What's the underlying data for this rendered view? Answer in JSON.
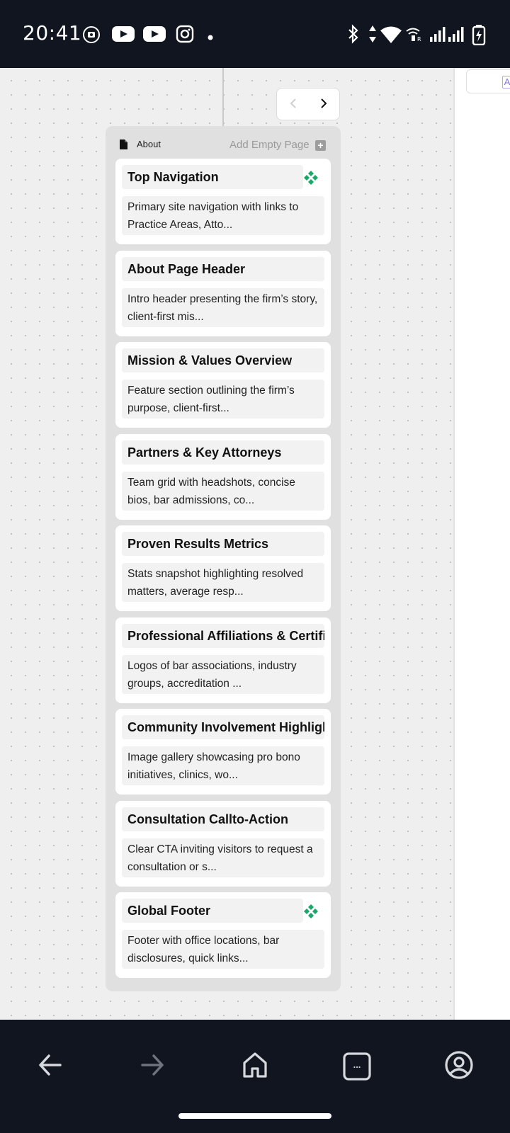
{
  "status_bar": {
    "time": "20:41",
    "left_icons": [
      "record-icon",
      "youtube-icon",
      "youtube-icon",
      "instagram-icon",
      "dot-icon"
    ],
    "right_icons": [
      "bluetooth-icon",
      "data-arrows-icon",
      "wifi-icon",
      "vowifi-icon",
      "signal-icon",
      "signal-icon",
      "battery-charging-icon"
    ]
  },
  "pager": {
    "prev_icon": "chevron-left-icon",
    "next_icon": "chevron-right-icon"
  },
  "right_panel": {
    "chip_text": "A"
  },
  "page": {
    "name": "About",
    "add_empty_label": "Add Empty Page",
    "add_icon": "plus-icon",
    "sections": [
      {
        "title": "Top Navigation",
        "description": "Primary site navigation with links to Practice Areas, Atto...",
        "global": true
      },
      {
        "title": "About Page Header",
        "description": "Intro header presenting the firm’s story, client-first mis...",
        "global": false
      },
      {
        "title": "Mission & Values Overview",
        "description": "Feature section outlining the firm’s purpose, client-first...",
        "global": false
      },
      {
        "title": "Partners & Key Attorneys",
        "description": "Team grid with headshots, concise bios, bar admissions, co...",
        "global": false
      },
      {
        "title": "Proven Results Metrics",
        "description": "Stats snapshot highlighting resolved matters, average resp...",
        "global": false
      },
      {
        "title": "Professional Affiliations & Certifications",
        "description": "Logos of bar associations, industry groups, accreditation ...",
        "global": false
      },
      {
        "title": "Community Involvement Highlights",
        "description": "Image gallery showcasing pro bono initiatives, clinics, wo...",
        "global": false
      },
      {
        "title": "Consultation Callto-Action",
        "description": "Clear CTA inviting visitors to request a consultation or s...",
        "global": false
      },
      {
        "title": "Global Footer",
        "description": "Footer with office locations, bar disclosures, quick links...",
        "global": true
      }
    ]
  },
  "colors": {
    "global_component": "#1aa86a",
    "accent_purple": "#8a72de"
  },
  "bottom_nav": {
    "items": [
      "back-icon",
      "forward-icon",
      "home-icon",
      "tabs-icon",
      "account-icon"
    ],
    "tabs_label": "..."
  }
}
